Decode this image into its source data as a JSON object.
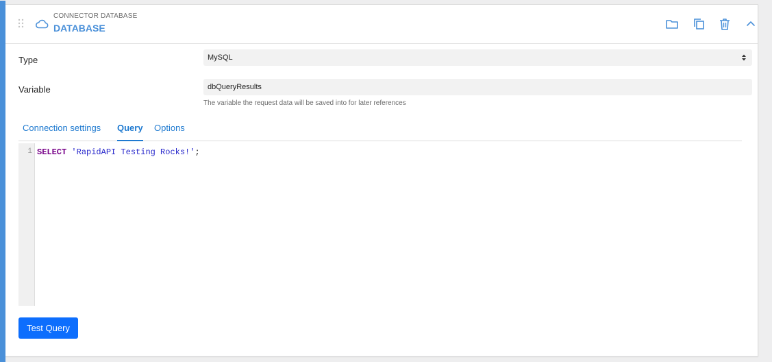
{
  "header": {
    "subtitle": "CONNECTOR DATABASE",
    "title": "DATABASE",
    "icons": [
      "drag-handle-icon",
      "cloud-icon",
      "folder-icon",
      "copy-icon",
      "trash-icon",
      "chevron-up-icon"
    ]
  },
  "form": {
    "type_label": "Type",
    "type_value": "MySQL",
    "variable_label": "Variable",
    "variable_value": "dbQueryResults",
    "variable_help": "The variable the request data will be saved into for later references"
  },
  "tabs": [
    {
      "label": "Connection settings",
      "active": false
    },
    {
      "label": "Query",
      "active": true
    },
    {
      "label": "Options",
      "active": false
    }
  ],
  "editor": {
    "line_number": "1",
    "keyword": "SELECT",
    "string": "'RapidAPI Testing Rocks!'",
    "terminator": ";"
  },
  "actions": {
    "test_query_label": "Test Query"
  },
  "colors": {
    "accent": "#4a90d9",
    "link": "#1f7ad0",
    "button": "#0d6efd"
  }
}
